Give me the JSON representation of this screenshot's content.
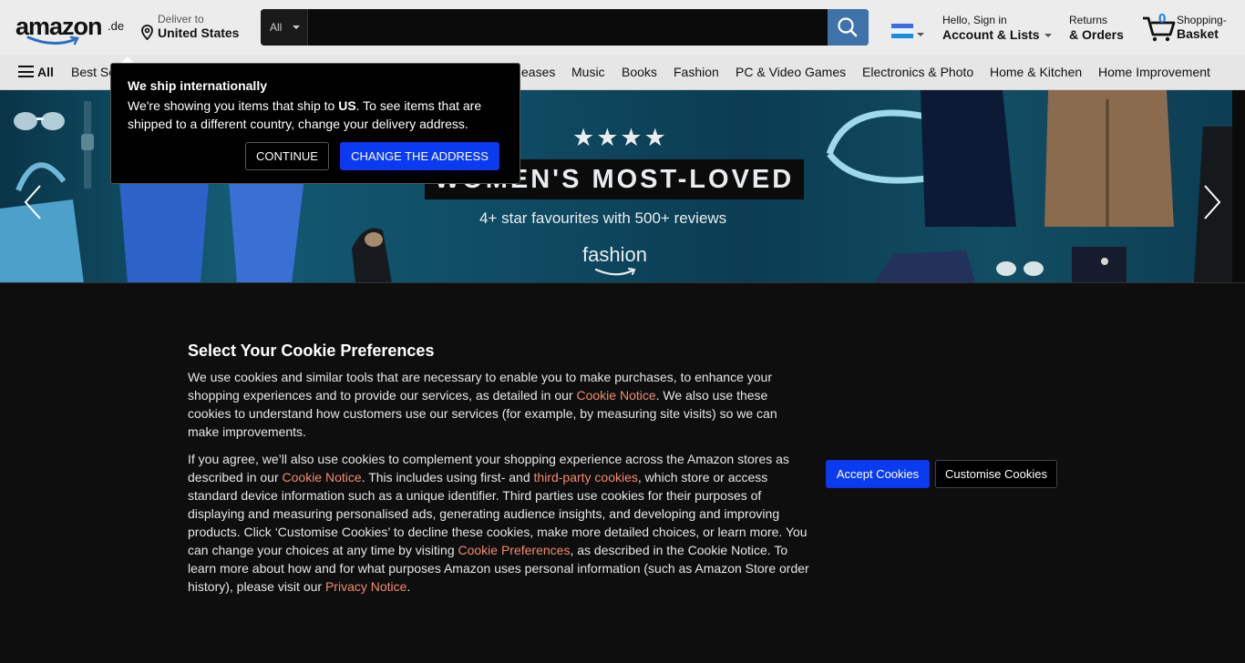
{
  "header": {
    "logo_text": "amazon",
    "logo_tld": ".de",
    "deliver_line1": "Deliver to",
    "deliver_line2": "United States",
    "search_category": "All",
    "search_placeholder": "",
    "account_line1": "Hello, Sign in",
    "account_line2": "Account & Lists",
    "returns_line1": "Returns",
    "returns_line2": "& Orders",
    "cart_count": "0",
    "cart_line1": "Shopping-",
    "cart_line2": "Basket"
  },
  "nav": {
    "all_label": "All",
    "items": [
      "Best Sellers",
      "eases",
      "Music",
      "Books",
      "Fashion",
      "PC & Video Games",
      "Electronics & Photo",
      "Home & Kitchen",
      "Home Improvement"
    ]
  },
  "hero": {
    "stars": "★★★★",
    "title": "WOMEN'S MOST-LOVED",
    "subtitle": "4+ star favourites with 500+ reviews",
    "brand": "fashion"
  },
  "popover": {
    "title": "We ship internationally",
    "body_prefix": "We're showing you items that ship to ",
    "body_country": "US",
    "body_suffix": ". To see items that are shipped to a different country, change your delivery address.",
    "continue_label": "CONTINUE",
    "change_label": "CHANGE THE ADDRESS"
  },
  "cookies": {
    "title": "Select Your Cookie Preferences",
    "p1_a": "We use cookies and similar tools that are necessary to enable you to make purchases, to enhance your shopping experiences and to provide our services, as detailed in our ",
    "p1_link": "Cookie Notice",
    "p1_b": ". We also use these cookies to understand how customers use our services (for example, by measuring site visits) so we can make improvements.",
    "p2_a": "If you agree, we’ll also use cookies to complement your shopping experience across the Amazon stores as described in our ",
    "p2_link1": "Cookie Notice",
    "p2_b": ". This includes using first- and ",
    "p2_link2": "third-party cookies",
    "p2_c": ", which store or access standard device information such as a unique identifier. Third parties use cookies for their purposes of displaying and measuring personalised ads, generating audience insights, and developing and improving products. Click ‘Customise Cookies’ to decline these cookies, make more detailed choices, or learn more. You can change your choices at any time by visiting ",
    "p2_link3": "Cookie Preferences",
    "p2_d": ", as described in the Cookie Notice. To learn more about how and for what purposes Amazon uses personal information (such as Amazon Store order history), please visit our ",
    "p2_link4": "Privacy Notice",
    "p2_e": ".",
    "accept_label": "Accept Cookies",
    "customise_label": "Customise Cookies"
  },
  "colors": {
    "accent_blue": "#0b3bf0",
    "link_orange": "#f28b6d",
    "cart_count": "#1d74e0"
  }
}
